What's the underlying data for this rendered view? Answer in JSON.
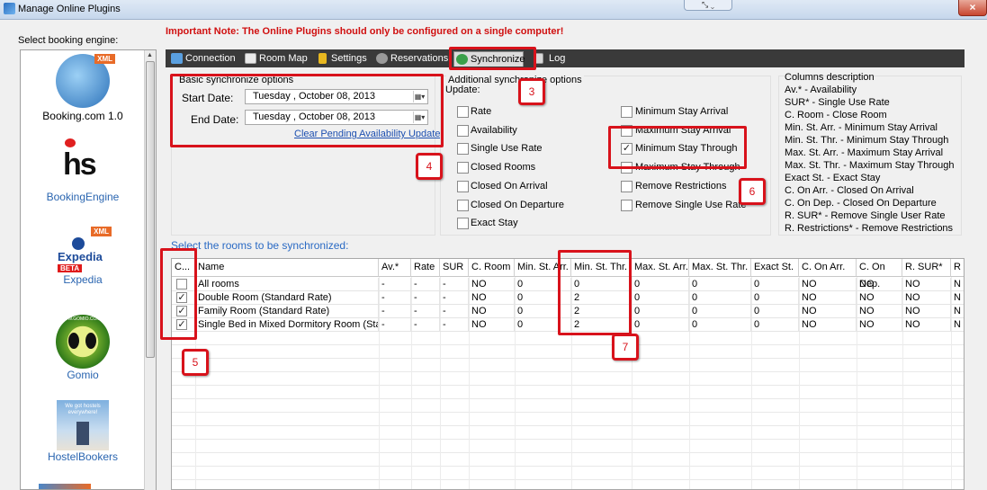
{
  "window": {
    "title": "Manage Online Plugins",
    "close_symbol": "×",
    "ctrl_symbols": "⤡ ⌄"
  },
  "left": {
    "label": "Select booking engine:",
    "engines": [
      {
        "name": "Booking.com 1.0",
        "icon": "booking-xml-globe-icon"
      },
      {
        "name": "BookingEngine",
        "icon": "bookingengine-hs-icon"
      },
      {
        "name": "Expedia",
        "icon": "expedia-beta-icon"
      },
      {
        "name": "Gomio",
        "icon": "gomio-icon"
      },
      {
        "name": "HostelBookers",
        "icon": "hostelbookers-icon"
      }
    ],
    "logo_text": {
      "xml": "XML",
      "hs": "hs",
      "expedia": "Expedia",
      "beta": "BETA",
      "gomio": "WWW.GOMIO.COM",
      "hb": "We got hostels everywhere!"
    }
  },
  "note": "Important Note: The Online Plugins should only be configured on a single computer!",
  "tabs": [
    {
      "label": "Connection",
      "icon": "connection-icon"
    },
    {
      "label": "Room Map",
      "icon": "room-map-icon"
    },
    {
      "label": "Settings",
      "icon": "settings-lock-icon"
    },
    {
      "label": "Reservations",
      "icon": "reservations-gear-icon"
    },
    {
      "label": "Synchronize",
      "icon": "synchronize-icon",
      "active": true
    },
    {
      "label": "Log",
      "icon": "log-icon"
    }
  ],
  "basic": {
    "title": "Basic synchronize options",
    "start_label": "Start Date:",
    "start_value": "Tuesday   ,   October   08, 2013",
    "end_label": "End Date:",
    "end_value": "Tuesday   ,   October   08, 2013",
    "clear_link": "Clear Pending Availability Updates"
  },
  "additional": {
    "title": "Additional synchronize options",
    "update_label": "Update:",
    "left_options": [
      {
        "label": "Rate",
        "checked": false
      },
      {
        "label": "Availability",
        "checked": false
      },
      {
        "label": "Single Use Rate",
        "checked": false
      },
      {
        "label": "Closed Rooms",
        "checked": false
      },
      {
        "label": "Closed On Arrival",
        "checked": false
      },
      {
        "label": "Closed On Departure",
        "checked": false
      },
      {
        "label": "Exact Stay",
        "checked": false
      }
    ],
    "right_options": [
      {
        "label": "Minimum Stay Arrival",
        "checked": false
      },
      {
        "label": "Maximum Stay Arrival",
        "checked": false
      },
      {
        "label": "Minimum Stay Through",
        "checked": true
      },
      {
        "label": "Maximum Stay Through",
        "checked": false
      },
      {
        "label": "Remove Restrictions",
        "checked": false
      },
      {
        "label": "Remove Single Use Rate",
        "checked": false
      }
    ]
  },
  "columns_desc": {
    "title": "Columns description",
    "lines": [
      "Av.* - Availability",
      "SUR* - Single Use Rate",
      "C. Room - Close Room",
      "Min. St. Arr. - Minimum Stay Arrival",
      "Min. St. Thr. - Minimum Stay Through",
      "Max. St. Arr. - Maximum Stay Arrival",
      "Max. St. Thr. - Maximum Stay Through",
      "Exact St. - Exact Stay",
      "C. On Arr. - Closed On Arrival",
      "C. On Dep. - Closed On Departure",
      "R. SUR* - Remove Single User Rate",
      "R. Restrictions* - Remove Restrictions"
    ]
  },
  "rooms_label": "Select the rooms to be synchronized:",
  "grid": {
    "headers": [
      "C...",
      "Name",
      "Av.*",
      "Rate",
      "SUR",
      "C. Room",
      "Min. St. Arr.",
      "Min. St. Thr.",
      "Max. St. Arr.",
      "Max. St. Thr.",
      "Exact St.",
      "C. On Arr.",
      "C. On Dep.",
      "R. SUR*",
      "R"
    ],
    "rows": [
      {
        "checked": false,
        "cells": [
          "All rooms",
          "-",
          "-",
          "-",
          "NO",
          "0",
          "0",
          "0",
          "0",
          "0",
          "NO",
          "NO",
          "NO",
          "N"
        ]
      },
      {
        "checked": true,
        "cells": [
          "Double Room (Standard Rate)",
          "-",
          "-",
          "-",
          "NO",
          "0",
          "2",
          "0",
          "0",
          "0",
          "NO",
          "NO",
          "NO",
          "N"
        ]
      },
      {
        "checked": true,
        "cells": [
          "Family Room (Standard Rate)",
          "-",
          "-",
          "-",
          "NO",
          "0",
          "2",
          "0",
          "0",
          "0",
          "NO",
          "NO",
          "NO",
          "N"
        ]
      },
      {
        "checked": true,
        "cells": [
          "Single Bed in Mixed Dormitory Room (Stand...",
          "-",
          "-",
          "-",
          "NO",
          "0",
          "2",
          "0",
          "0",
          "0",
          "NO",
          "NO",
          "NO",
          "N"
        ]
      }
    ]
  },
  "callouts": [
    "3",
    "4",
    "5",
    "6",
    "7"
  ],
  "colors": {
    "accent_red": "#d8121b",
    "note_red": "#d01010",
    "tabbar": "#3a3a3a",
    "link": "#1c4fb0"
  }
}
